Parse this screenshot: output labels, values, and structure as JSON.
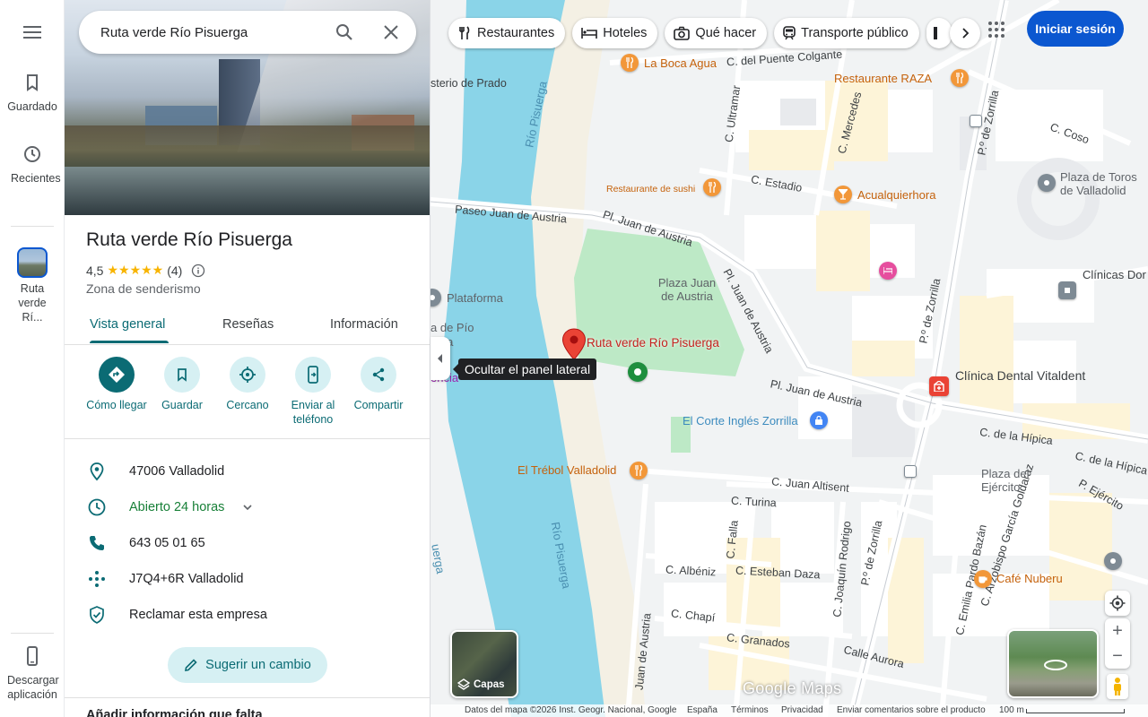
{
  "rail": {
    "saved": "Guardado",
    "recent": "Recientes",
    "recent_place": "Ruta verde Rí...",
    "download": "Descargar aplicación"
  },
  "search": {
    "value": "Ruta verde Río Pisuerga"
  },
  "place": {
    "title": "Ruta verde Río Pisuerga",
    "rating": "4,5",
    "stars": "★★★★★",
    "reviews": "(4)",
    "category": "Zona de senderismo"
  },
  "tabs": [
    {
      "label": "Vista general"
    },
    {
      "label": "Reseñas"
    },
    {
      "label": "Información"
    }
  ],
  "actions": [
    {
      "label": "Cómo llegar"
    },
    {
      "label": "Guardar"
    },
    {
      "label": "Cercano"
    },
    {
      "label": "Enviar al teléfono"
    },
    {
      "label": "Compartir"
    }
  ],
  "details": {
    "address": "47006 Valladolid",
    "hours": "Abierto 24 horas",
    "phone": "643 05 01 65",
    "pluscode": "J7Q4+6R Valladolid",
    "claim": "Reclamar esta empresa"
  },
  "suggest": "Sugerir un cambio",
  "more_section": "Añadir información que falta",
  "map": {
    "chips": [
      {
        "label": "Restaurantes",
        "icon": "fork-knife-icon"
      },
      {
        "label": "Hoteles",
        "icon": "bed-icon"
      },
      {
        "label": "Qué hacer",
        "icon": "camera-icon"
      },
      {
        "label": "Transporte público",
        "icon": "train-icon"
      }
    ],
    "signin": "Iniciar sesión",
    "tooltip": "Ocultar el panel lateral",
    "layers": "Capas",
    "logo": "Google Maps",
    "streets": {
      "puente_colgante": "C. del Puente Colgante",
      "ultramar": "C. Ultramar",
      "mercedes": "C. Mercedes",
      "estadio": "C. Estadio",
      "paseo_austria": "Paseo Juan de Austria",
      "pl_austria_1": "Pl. Juan de Austria",
      "pl_austria_2": "Pl. Juan de Austria",
      "pl_austria_3": "Pl. Juan de Austria",
      "zorrilla_1": "P.º de Zorrilla",
      "zorrilla_2": "P.º de Zorrilla",
      "zorrilla_3": "P.º de Zorrilla",
      "hipica_1": "C. de la Hípica",
      "hipica_2": "C. de la Hípica",
      "altisent": "C. Juan Altisent",
      "turina": "C. Turina",
      "falla": "C. Falla",
      "rodrigo": "C. Joaquín Rodrigo",
      "albeniz": "C. Albéniz",
      "daza": "C. Esteban Daza",
      "chapi": "C. Chapí",
      "granados": "C. Granados",
      "aurora": "Calle Aurora",
      "pardo_bazan": "C. Emilia Pardo Bazán",
      "goldaraz": "C. Arzobispo García Goldaraz",
      "ejercito": "P. Ejército",
      "coso": "C. Coso",
      "juan_austria_v": "Juan de Austria"
    },
    "places": {
      "boca_agua": "La Boca Agua",
      "raza": "Restaurante RAZA",
      "sushi": "Restaurante de sushi",
      "acualquierhora": "Acualquierhora",
      "toros": "Plaza de Toros de Valladolid",
      "clinicas": "Clínicas Dor y Medicina F",
      "plaza_austria": "Plaza Juan de Austria",
      "ruta": "Ruta verde Río Pisuerga",
      "plataforma": "Plataforma",
      "pio": "a de Pío",
      "pio2": "tega",
      "corte_ingles": "El Corte Inglés Zorrilla",
      "dental": "Clínica Dental Vitaldent",
      "trebol": "El Trébol Valladolid",
      "plaza_ejercito": "Plaza del Ejército",
      "nuberu": "Café Nuberu",
      "prado": "sterio de Prado",
      "rio_1": "Río Pisuerga",
      "rio_2": "Río Pisuerga",
      "rio_3": "uerga",
      "cencia": "encia"
    }
  },
  "footer": {
    "data": "Datos del mapa ©2026 Inst. Geogr. Nacional, Google",
    "country": "España",
    "terms": "Términos",
    "privacy": "Privacidad",
    "feedback": "Enviar comentarios sobre el producto",
    "scale": "100 m"
  },
  "colors": {
    "accent": "#0b6b74",
    "accent_light": "#d6f0f3",
    "signin": "#0b57d0",
    "river": "#8ad4e8",
    "park": "#bde9c6",
    "food_pin": "#f29739",
    "marker": "#ea4335",
    "hotel_pin": "#e64e9e"
  }
}
